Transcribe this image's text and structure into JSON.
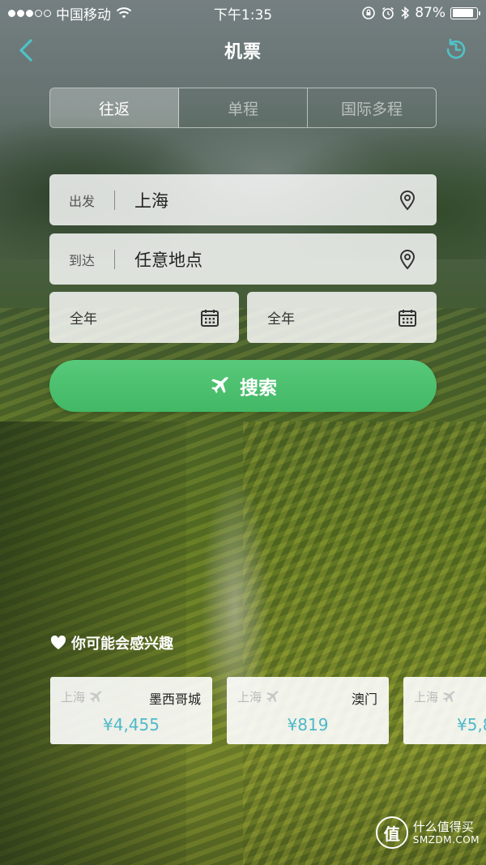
{
  "status_bar": {
    "carrier": "中国移动",
    "time": "下午1:35",
    "battery": "87%",
    "battery_level": 0.87
  },
  "nav": {
    "title": "机票",
    "back_icon": "chevron-left-icon",
    "history_icon": "history-clock-icon",
    "accent_color": "#4fc3c8"
  },
  "tabs": [
    {
      "label": "往返",
      "active": true
    },
    {
      "label": "单程",
      "active": false
    },
    {
      "label": "国际多程",
      "active": false
    }
  ],
  "form": {
    "depart": {
      "label": "出发",
      "value": "上海",
      "icon": "location-pin-icon"
    },
    "arrive": {
      "label": "到达",
      "value": "任意地点",
      "icon": "location-pin-icon"
    },
    "date_depart": {
      "label": "全年",
      "icon": "calendar-icon"
    },
    "date_return": {
      "label": "全年",
      "icon": "calendar-icon"
    }
  },
  "search": {
    "label": "搜索",
    "icon": "airplane-icon",
    "color": "#4cc06f"
  },
  "interest": {
    "title": "你可能会感兴趣",
    "icon": "heart-icon",
    "cards": [
      {
        "from": "上海",
        "to": "墨西哥城",
        "price": "¥4,455"
      },
      {
        "from": "上海",
        "to": "澳门",
        "price": "¥819"
      },
      {
        "from": "上海",
        "to": "",
        "price": "¥5,8"
      }
    ],
    "price_color": "#4fb9c8"
  },
  "watermark": {
    "logo": "值",
    "line1": "什么值得买",
    "line2": "SMZDM.COM"
  }
}
